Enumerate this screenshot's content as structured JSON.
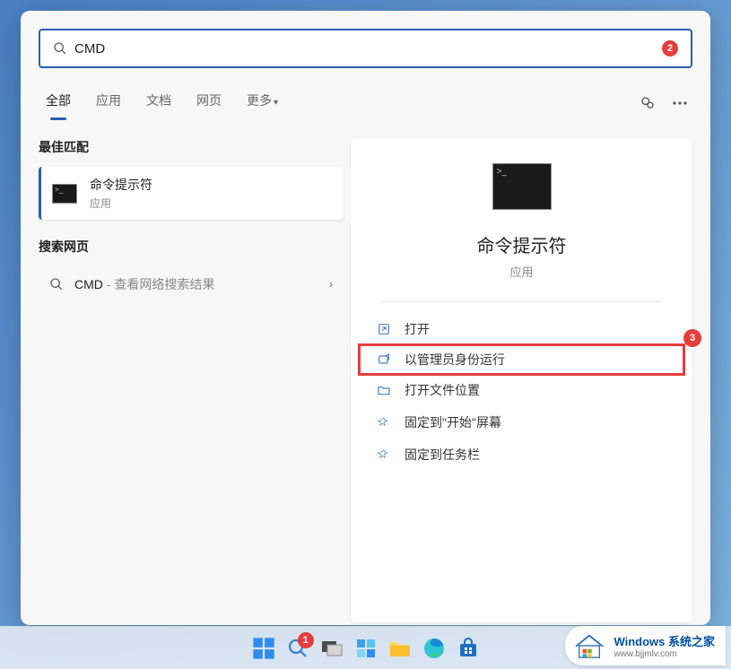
{
  "search": {
    "value": "CMD",
    "badge": "2"
  },
  "tabs": {
    "all": "全部",
    "apps": "应用",
    "docs": "文档",
    "web": "网页",
    "more": "更多"
  },
  "left": {
    "best_match_label": "最佳匹配",
    "best_title": "命令提示符",
    "best_sub": "应用",
    "web_label": "搜索网页",
    "web_item_prefix": "CMD",
    "web_item_suffix": " - 查看网络搜索结果"
  },
  "right": {
    "title": "命令提示符",
    "sub": "应用",
    "actions": {
      "open": "打开",
      "run_admin": "以管理员身份运行",
      "open_location": "打开文件位置",
      "pin_start": "固定到\"开始\"屏幕",
      "pin_taskbar": "固定到任务栏"
    },
    "callout_num": "3"
  },
  "taskbar": {
    "search_badge": "1"
  },
  "watermark": {
    "title": "Windows 系统之家",
    "url": "www.bjjmlv.com"
  }
}
